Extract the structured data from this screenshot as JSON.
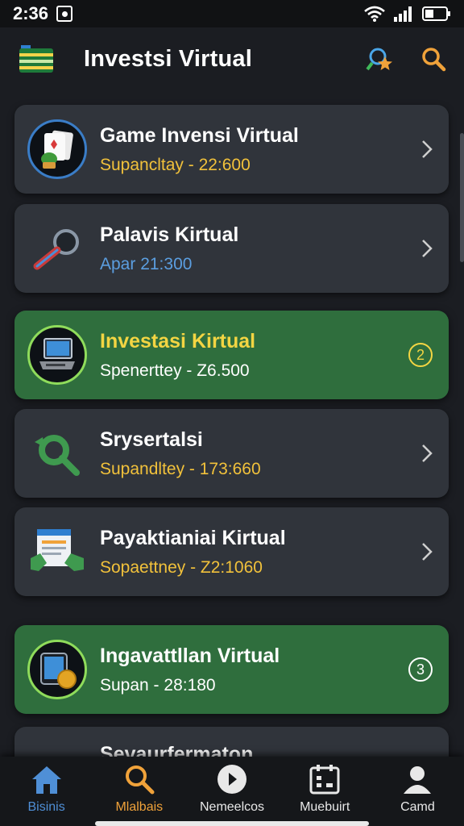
{
  "status_bar": {
    "time": "2:36"
  },
  "header": {
    "title": "Investsi Virtual"
  },
  "items": [
    {
      "title": "Game Invensi Virtual",
      "subtitle": "Supancltay - 22:600",
      "subtitle_color": "#f1c13b",
      "highlighted": false,
      "icon": "cards-plant-icon"
    },
    {
      "title": "Palavis Kirtual",
      "subtitle": "Apar 21:300",
      "subtitle_color": "#5b9ee0",
      "highlighted": false,
      "icon": "magnifier-icon"
    },
    {
      "title": "Investasi Kirtual",
      "subtitle": "Spenerttey - Z6.500",
      "subtitle_color": "#ffffff",
      "highlighted": true,
      "badge": "2",
      "icon": "laptop-icon"
    },
    {
      "title": "Srysertalsi",
      "subtitle": "Supandltey - 173:660",
      "subtitle_color": "#f1c13b",
      "highlighted": false,
      "icon": "refresh-search-icon"
    },
    {
      "title": "Payaktianiai Kirtual",
      "subtitle": "Sopaettney - Z2:1060",
      "subtitle_color": "#f1c13b",
      "highlighted": false,
      "icon": "document-hands-icon"
    },
    {
      "title": "Ingavattllan Virtual",
      "subtitle": "Supan - 28:180",
      "subtitle_color": "#ffffff",
      "highlighted": true,
      "badge": "3",
      "icon": "tablet-coin-icon"
    },
    {
      "title": "Sevaurfermaton",
      "subtitle": "",
      "subtitle_color": "#f1c13b",
      "highlighted": false,
      "icon": "folder-icon"
    }
  ],
  "bottom_nav": [
    {
      "label": "Bisinis",
      "color": "#4f8fd6",
      "icon": "home-icon"
    },
    {
      "label": "Mlalbais",
      "color": "#f0a23a",
      "icon": "search-icon"
    },
    {
      "label": "Nemeelcos",
      "color": "#e8e8e8",
      "icon": "play-icon"
    },
    {
      "label": "Muebuirt",
      "color": "#e8e8e8",
      "icon": "calendar-icon"
    },
    {
      "label": "Camd",
      "color": "#e8e8e8",
      "icon": "user-icon"
    }
  ],
  "colors": {
    "background": "#1b1d22",
    "card": "#30343b",
    "highlight": "#2f6e3d",
    "accent_orange": "#f0a23a"
  }
}
